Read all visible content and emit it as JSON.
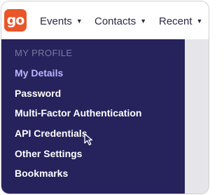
{
  "logo": {
    "text": "go",
    "color": "#e8562a"
  },
  "nav": {
    "events": {
      "label": "Events"
    },
    "contacts": {
      "label": "Contacts"
    },
    "recent": {
      "label": "Recent"
    }
  },
  "menu": {
    "heading": "MY PROFILE",
    "items": [
      {
        "label": "My Details",
        "active": true
      },
      {
        "label": "Password",
        "active": false
      },
      {
        "label": "Multi-Factor Authentication",
        "active": false
      },
      {
        "label": "API Credentials",
        "active": false
      },
      {
        "label": "Other Settings",
        "active": false
      },
      {
        "label": "Bookmarks",
        "active": false
      }
    ]
  },
  "colors": {
    "menu_background": "#25225c",
    "active_item": "#b9b6ff",
    "accent": "#e8562a"
  },
  "icons": {
    "cursor": "arrow-cursor-icon",
    "caret": "caret-down-icon"
  }
}
